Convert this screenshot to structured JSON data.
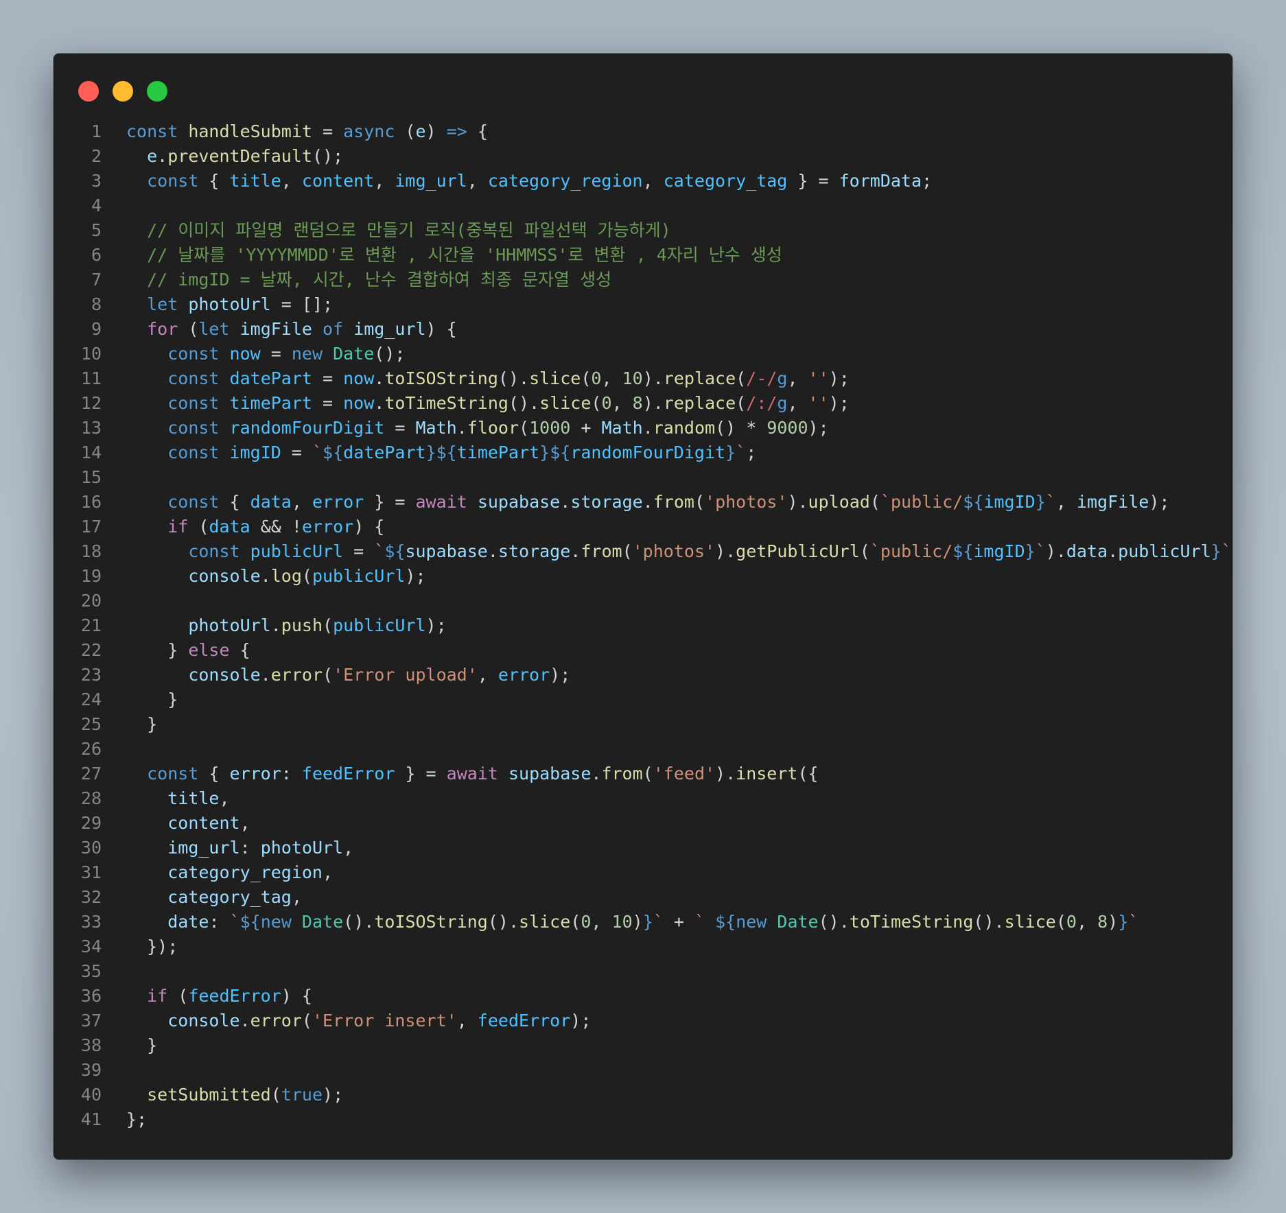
{
  "window": {
    "controls": [
      {
        "name": "close",
        "color": "#ff5f57"
      },
      {
        "name": "minimize",
        "color": "#febc2e"
      },
      {
        "name": "maximize",
        "color": "#28c840"
      }
    ]
  },
  "code": {
    "language": "javascript",
    "lines": [
      [
        [
          "kw",
          "const"
        ],
        [
          "pun",
          " "
        ],
        [
          "fn",
          "handleSubmit"
        ],
        [
          "pun",
          " = "
        ],
        [
          "kw",
          "async"
        ],
        [
          "pun",
          " ("
        ],
        [
          "var",
          "e"
        ],
        [
          "pun",
          ") "
        ],
        [
          "kw",
          "=>"
        ],
        [
          "pun",
          " {"
        ]
      ],
      [
        [
          "pun",
          "  "
        ],
        [
          "var",
          "e"
        ],
        [
          "pun",
          "."
        ],
        [
          "fn",
          "preventDefault"
        ],
        [
          "pun",
          "();"
        ]
      ],
      [
        [
          "pun",
          "  "
        ],
        [
          "kw",
          "const"
        ],
        [
          "pun",
          " { "
        ],
        [
          "con",
          "title"
        ],
        [
          "pun",
          ", "
        ],
        [
          "con",
          "content"
        ],
        [
          "pun",
          ", "
        ],
        [
          "con",
          "img_url"
        ],
        [
          "pun",
          ", "
        ],
        [
          "con",
          "category_region"
        ],
        [
          "pun",
          ", "
        ],
        [
          "con",
          "category_tag"
        ],
        [
          "pun",
          " } = "
        ],
        [
          "var",
          "formData"
        ],
        [
          "pun",
          ";"
        ]
      ],
      [],
      [
        [
          "cmt",
          "  // 이미지 파일명 랜덤으로 만들기 로직(중복된 파일선택 가능하게)"
        ]
      ],
      [
        [
          "cmt",
          "  // 날짜를 'YYYYMMDD'로 변환 , 시간을 'HHMMSS'로 변환 , 4자리 난수 생성"
        ]
      ],
      [
        [
          "cmt",
          "  // imgID = 날짜, 시간, 난수 결합하여 최종 문자열 생성"
        ]
      ],
      [
        [
          "pun",
          "  "
        ],
        [
          "kw",
          "let"
        ],
        [
          "pun",
          " "
        ],
        [
          "var",
          "photoUrl"
        ],
        [
          "pun",
          " = [];"
        ]
      ],
      [
        [
          "pun",
          "  "
        ],
        [
          "ctl",
          "for"
        ],
        [
          "pun",
          " ("
        ],
        [
          "kw",
          "let"
        ],
        [
          "pun",
          " "
        ],
        [
          "var",
          "imgFile"
        ],
        [
          "pun",
          " "
        ],
        [
          "kw",
          "of"
        ],
        [
          "pun",
          " "
        ],
        [
          "var",
          "img_url"
        ],
        [
          "pun",
          ") {"
        ]
      ],
      [
        [
          "pun",
          "    "
        ],
        [
          "kw",
          "const"
        ],
        [
          "pun",
          " "
        ],
        [
          "con",
          "now"
        ],
        [
          "pun",
          " = "
        ],
        [
          "kw",
          "new"
        ],
        [
          "pun",
          " "
        ],
        [
          "typ",
          "Date"
        ],
        [
          "pun",
          "();"
        ]
      ],
      [
        [
          "pun",
          "    "
        ],
        [
          "kw",
          "const"
        ],
        [
          "pun",
          " "
        ],
        [
          "con",
          "datePart"
        ],
        [
          "pun",
          " = "
        ],
        [
          "con",
          "now"
        ],
        [
          "pun",
          "."
        ],
        [
          "fn",
          "toISOString"
        ],
        [
          "pun",
          "()."
        ],
        [
          "fn",
          "slice"
        ],
        [
          "pun",
          "("
        ],
        [
          "num",
          "0"
        ],
        [
          "pun",
          ", "
        ],
        [
          "num",
          "10"
        ],
        [
          "pun",
          ")."
        ],
        [
          "fn",
          "replace"
        ],
        [
          "pun",
          "("
        ],
        [
          "rgx",
          "/-/"
        ],
        [
          "kw",
          "g"
        ],
        [
          "pun",
          ", "
        ],
        [
          "str",
          "''"
        ],
        [
          "pun",
          ");"
        ]
      ],
      [
        [
          "pun",
          "    "
        ],
        [
          "kw",
          "const"
        ],
        [
          "pun",
          " "
        ],
        [
          "con",
          "timePart"
        ],
        [
          "pun",
          " = "
        ],
        [
          "con",
          "now"
        ],
        [
          "pun",
          "."
        ],
        [
          "fn",
          "toTimeString"
        ],
        [
          "pun",
          "()."
        ],
        [
          "fn",
          "slice"
        ],
        [
          "pun",
          "("
        ],
        [
          "num",
          "0"
        ],
        [
          "pun",
          ", "
        ],
        [
          "num",
          "8"
        ],
        [
          "pun",
          ")."
        ],
        [
          "fn",
          "replace"
        ],
        [
          "pun",
          "("
        ],
        [
          "rgx",
          "/:/"
        ],
        [
          "kw",
          "g"
        ],
        [
          "pun",
          ", "
        ],
        [
          "str",
          "''"
        ],
        [
          "pun",
          ");"
        ]
      ],
      [
        [
          "pun",
          "    "
        ],
        [
          "kw",
          "const"
        ],
        [
          "pun",
          " "
        ],
        [
          "con",
          "randomFourDigit"
        ],
        [
          "pun",
          " = "
        ],
        [
          "var",
          "Math"
        ],
        [
          "pun",
          "."
        ],
        [
          "fn",
          "floor"
        ],
        [
          "pun",
          "("
        ],
        [
          "num",
          "1000"
        ],
        [
          "pun",
          " + "
        ],
        [
          "var",
          "Math"
        ],
        [
          "pun",
          "."
        ],
        [
          "fn",
          "random"
        ],
        [
          "pun",
          "() * "
        ],
        [
          "num",
          "9000"
        ],
        [
          "pun",
          ");"
        ]
      ],
      [
        [
          "pun",
          "    "
        ],
        [
          "kw",
          "const"
        ],
        [
          "pun",
          " "
        ],
        [
          "con",
          "imgID"
        ],
        [
          "pun",
          " = "
        ],
        [
          "str",
          "`"
        ],
        [
          "kw",
          "${"
        ],
        [
          "con",
          "datePart"
        ],
        [
          "kw",
          "}${"
        ],
        [
          "con",
          "timePart"
        ],
        [
          "kw",
          "}${"
        ],
        [
          "con",
          "randomFourDigit"
        ],
        [
          "kw",
          "}"
        ],
        [
          "str",
          "`"
        ],
        [
          "pun",
          ";"
        ]
      ],
      [],
      [
        [
          "pun",
          "    "
        ],
        [
          "kw",
          "const"
        ],
        [
          "pun",
          " { "
        ],
        [
          "con",
          "data"
        ],
        [
          "pun",
          ", "
        ],
        [
          "con",
          "error"
        ],
        [
          "pun",
          " } = "
        ],
        [
          "ctl",
          "await"
        ],
        [
          "pun",
          " "
        ],
        [
          "var",
          "supabase"
        ],
        [
          "pun",
          "."
        ],
        [
          "var",
          "storage"
        ],
        [
          "pun",
          "."
        ],
        [
          "fn",
          "from"
        ],
        [
          "pun",
          "("
        ],
        [
          "str",
          "'photos'"
        ],
        [
          "pun",
          ")."
        ],
        [
          "fn",
          "upload"
        ],
        [
          "pun",
          "("
        ],
        [
          "str",
          "`public/"
        ],
        [
          "kw",
          "${"
        ],
        [
          "con",
          "imgID"
        ],
        [
          "kw",
          "}"
        ],
        [
          "str",
          "`"
        ],
        [
          "pun",
          ", "
        ],
        [
          "var",
          "imgFile"
        ],
        [
          "pun",
          ");"
        ]
      ],
      [
        [
          "pun",
          "    "
        ],
        [
          "ctl",
          "if"
        ],
        [
          "pun",
          " ("
        ],
        [
          "con",
          "data"
        ],
        [
          "pun",
          " && !"
        ],
        [
          "con",
          "error"
        ],
        [
          "pun",
          ") {"
        ]
      ],
      [
        [
          "pun",
          "      "
        ],
        [
          "kw",
          "const"
        ],
        [
          "pun",
          " "
        ],
        [
          "con",
          "publicUrl"
        ],
        [
          "pun",
          " = "
        ],
        [
          "str",
          "`"
        ],
        [
          "kw",
          "${"
        ],
        [
          "var",
          "supabase"
        ],
        [
          "pun",
          "."
        ],
        [
          "var",
          "storage"
        ],
        [
          "pun",
          "."
        ],
        [
          "fn",
          "from"
        ],
        [
          "pun",
          "("
        ],
        [
          "str",
          "'photos'"
        ],
        [
          "pun",
          ")."
        ],
        [
          "fn",
          "getPublicUrl"
        ],
        [
          "pun",
          "("
        ],
        [
          "str",
          "`public/"
        ],
        [
          "kw",
          "${"
        ],
        [
          "con",
          "imgID"
        ],
        [
          "kw",
          "}"
        ],
        [
          "str",
          "`"
        ],
        [
          "pun",
          ")."
        ],
        [
          "var",
          "data"
        ],
        [
          "pun",
          "."
        ],
        [
          "var",
          "publicUrl"
        ],
        [
          "kw",
          "}"
        ],
        [
          "str",
          "`"
        ],
        [
          "pun",
          ";"
        ]
      ],
      [
        [
          "pun",
          "      "
        ],
        [
          "var",
          "console"
        ],
        [
          "pun",
          "."
        ],
        [
          "fn",
          "log"
        ],
        [
          "pun",
          "("
        ],
        [
          "con",
          "publicUrl"
        ],
        [
          "pun",
          ");"
        ]
      ],
      [],
      [
        [
          "pun",
          "      "
        ],
        [
          "var",
          "photoUrl"
        ],
        [
          "pun",
          "."
        ],
        [
          "fn",
          "push"
        ],
        [
          "pun",
          "("
        ],
        [
          "con",
          "publicUrl"
        ],
        [
          "pun",
          ");"
        ]
      ],
      [
        [
          "pun",
          "    } "
        ],
        [
          "ctl",
          "else"
        ],
        [
          "pun",
          " {"
        ]
      ],
      [
        [
          "pun",
          "      "
        ],
        [
          "var",
          "console"
        ],
        [
          "pun",
          "."
        ],
        [
          "fn",
          "error"
        ],
        [
          "pun",
          "("
        ],
        [
          "str",
          "'Error upload'"
        ],
        [
          "pun",
          ", "
        ],
        [
          "con",
          "error"
        ],
        [
          "pun",
          ");"
        ]
      ],
      [
        [
          "pun",
          "    }"
        ]
      ],
      [
        [
          "pun",
          "  }"
        ]
      ],
      [],
      [
        [
          "pun",
          "  "
        ],
        [
          "kw",
          "const"
        ],
        [
          "pun",
          " { "
        ],
        [
          "var",
          "error"
        ],
        [
          "pun",
          ": "
        ],
        [
          "con",
          "feedError"
        ],
        [
          "pun",
          " } = "
        ],
        [
          "ctl",
          "await"
        ],
        [
          "pun",
          " "
        ],
        [
          "var",
          "supabase"
        ],
        [
          "pun",
          "."
        ],
        [
          "fn",
          "from"
        ],
        [
          "pun",
          "("
        ],
        [
          "str",
          "'feed'"
        ],
        [
          "pun",
          ")."
        ],
        [
          "fn",
          "insert"
        ],
        [
          "pun",
          "({"
        ]
      ],
      [
        [
          "pun",
          "    "
        ],
        [
          "var",
          "title"
        ],
        [
          "pun",
          ","
        ]
      ],
      [
        [
          "pun",
          "    "
        ],
        [
          "var",
          "content"
        ],
        [
          "pun",
          ","
        ]
      ],
      [
        [
          "pun",
          "    "
        ],
        [
          "var",
          "img_url"
        ],
        [
          "pun",
          ": "
        ],
        [
          "var",
          "photoUrl"
        ],
        [
          "pun",
          ","
        ]
      ],
      [
        [
          "pun",
          "    "
        ],
        [
          "var",
          "category_region"
        ],
        [
          "pun",
          ","
        ]
      ],
      [
        [
          "pun",
          "    "
        ],
        [
          "var",
          "category_tag"
        ],
        [
          "pun",
          ","
        ]
      ],
      [
        [
          "pun",
          "    "
        ],
        [
          "var",
          "date"
        ],
        [
          "pun",
          ": "
        ],
        [
          "str",
          "`"
        ],
        [
          "kw",
          "${new "
        ],
        [
          "typ",
          "Date"
        ],
        [
          "pun",
          "()."
        ],
        [
          "fn",
          "toISOString"
        ],
        [
          "pun",
          "()."
        ],
        [
          "fn",
          "slice"
        ],
        [
          "pun",
          "("
        ],
        [
          "num",
          "0"
        ],
        [
          "pun",
          ", "
        ],
        [
          "num",
          "10"
        ],
        [
          "pun",
          ")"
        ],
        [
          "kw",
          "}"
        ],
        [
          "str",
          "`"
        ],
        [
          "pun",
          " + "
        ],
        [
          "str",
          "` "
        ],
        [
          "kw",
          "${new "
        ],
        [
          "typ",
          "Date"
        ],
        [
          "pun",
          "()."
        ],
        [
          "fn",
          "toTimeString"
        ],
        [
          "pun",
          "()."
        ],
        [
          "fn",
          "slice"
        ],
        [
          "pun",
          "("
        ],
        [
          "num",
          "0"
        ],
        [
          "pun",
          ", "
        ],
        [
          "num",
          "8"
        ],
        [
          "pun",
          ")"
        ],
        [
          "kw",
          "}"
        ],
        [
          "str",
          "`"
        ]
      ],
      [
        [
          "pun",
          "  });"
        ]
      ],
      [],
      [
        [
          "pun",
          "  "
        ],
        [
          "ctl",
          "if"
        ],
        [
          "pun",
          " ("
        ],
        [
          "con",
          "feedError"
        ],
        [
          "pun",
          ") {"
        ]
      ],
      [
        [
          "pun",
          "    "
        ],
        [
          "var",
          "console"
        ],
        [
          "pun",
          "."
        ],
        [
          "fn",
          "error"
        ],
        [
          "pun",
          "("
        ],
        [
          "str",
          "'Error insert'"
        ],
        [
          "pun",
          ", "
        ],
        [
          "con",
          "feedError"
        ],
        [
          "pun",
          ");"
        ]
      ],
      [
        [
          "pun",
          "  }"
        ]
      ],
      [],
      [
        [
          "pun",
          "  "
        ],
        [
          "fn",
          "setSubmitted"
        ],
        [
          "pun",
          "("
        ],
        [
          "kw",
          "true"
        ],
        [
          "pun",
          ");"
        ]
      ],
      [
        [
          "pun",
          "};"
        ]
      ]
    ]
  }
}
